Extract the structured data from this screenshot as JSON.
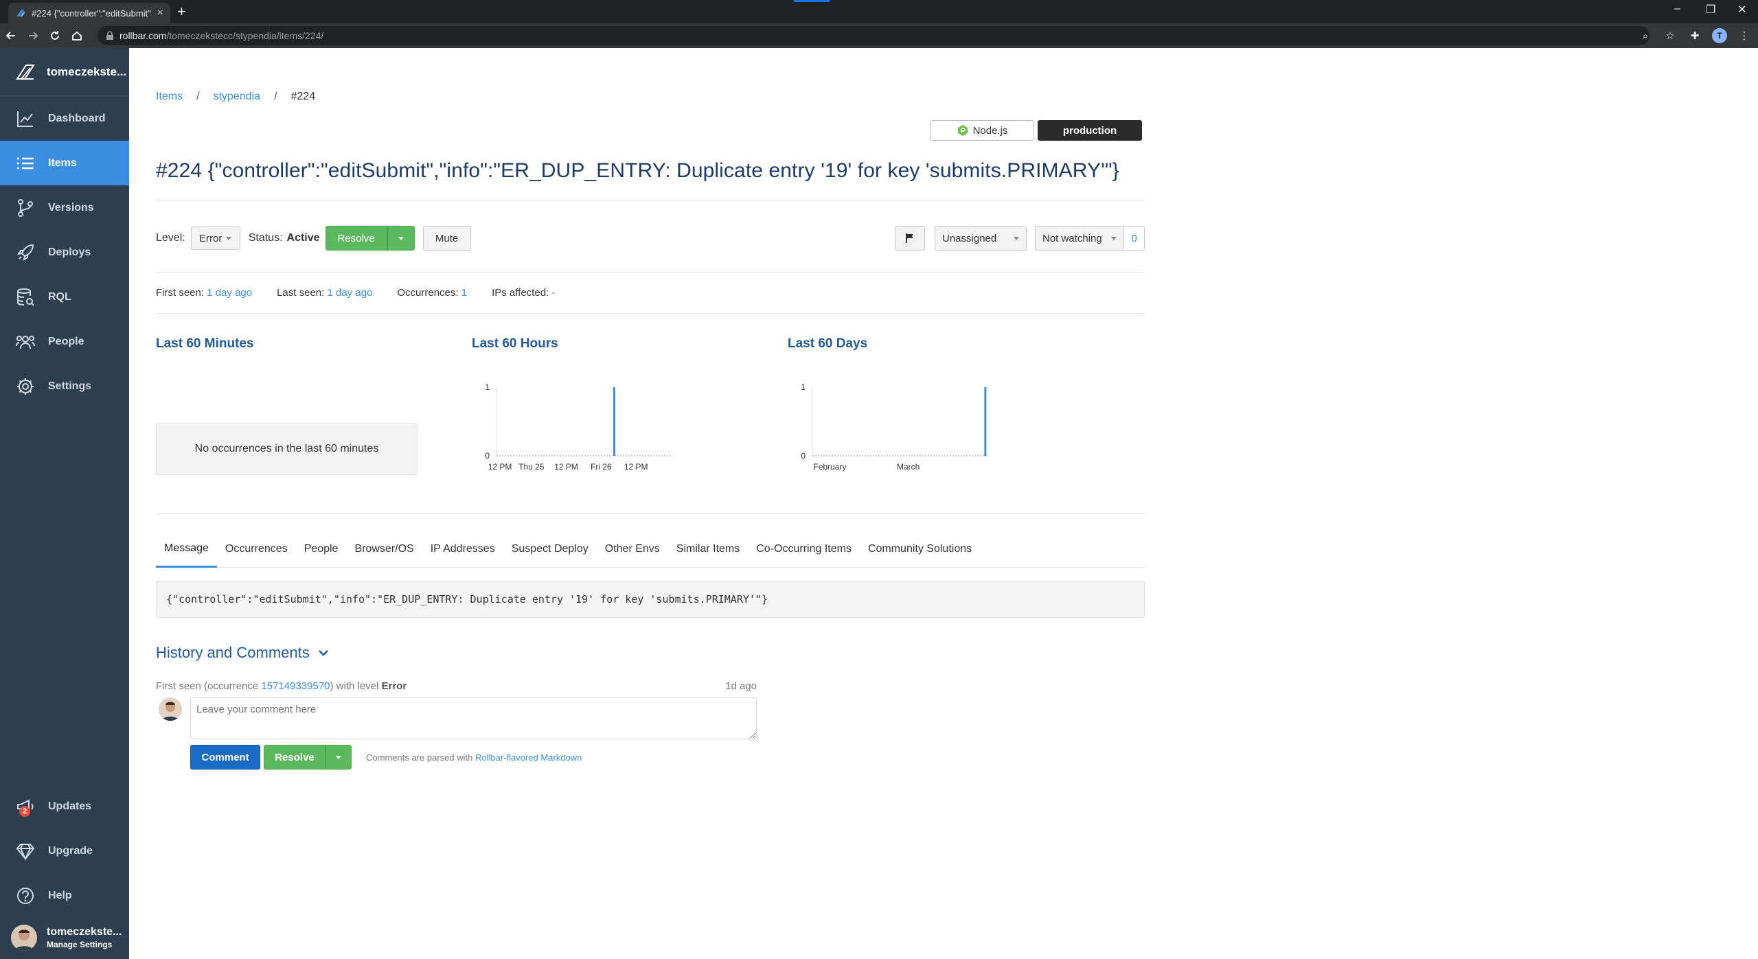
{
  "browser": {
    "tab_title": "#224 {\"controller\":\"editSubmit\",\"i",
    "url_host": "rollbar.com",
    "url_path": "/tomeczekstecc/stypendia/items/224/",
    "profile_initial": "T"
  },
  "sidebar": {
    "brand": "tomeczekste...",
    "items": [
      {
        "label": "Dashboard",
        "icon": "chart-line-icon"
      },
      {
        "label": "Items",
        "icon": "list-icon"
      },
      {
        "label": "Versions",
        "icon": "branch-icon"
      },
      {
        "label": "Deploys",
        "icon": "rocket-icon"
      },
      {
        "label": "RQL",
        "icon": "database-search-icon"
      },
      {
        "label": "People",
        "icon": "people-icon"
      },
      {
        "label": "Settings",
        "icon": "gear-icon"
      }
    ],
    "bottom_items": [
      {
        "label": "Updates",
        "icon": "megaphone-icon",
        "badge": "2"
      },
      {
        "label": "Upgrade",
        "icon": "diamond-icon"
      },
      {
        "label": "Help",
        "icon": "help-icon"
      }
    ],
    "user": {
      "name": "tomeczekste...",
      "sub": "Manage Settings"
    }
  },
  "breadcrumb": {
    "items": "Items",
    "project": "stypendia",
    "current": "#224",
    "sep": "/"
  },
  "env": {
    "platform": "Node.js",
    "environment": "production"
  },
  "title": "#224 {\"controller\":\"editSubmit\",\"info\":\"ER_DUP_ENTRY: Duplicate entry '19' for key 'submits.PRIMARY'\"}",
  "status": {
    "level_label": "Level:",
    "level_value": "Error",
    "status_label": "Status:",
    "status_value": "Active",
    "resolve": "Resolve",
    "mute": "Mute",
    "assignee": "Unassigned",
    "watching": "Not watching",
    "watch_count": "0"
  },
  "seen": {
    "first_label": "First seen:",
    "first_value": "1 day ago",
    "last_label": "Last seen:",
    "last_value": "1 day ago",
    "occ_label": "Occurrences:",
    "occ_value": "1",
    "ips_label": "IPs affected:",
    "ips_value": "-"
  },
  "charts_section": {
    "minutes_title": "Last 60 Minutes",
    "minutes_empty": "No occurrences in the last 60 minutes",
    "hours_title": "Last 60 Hours",
    "days_title": "Last 60 Days"
  },
  "chart_data": [
    {
      "type": "bar",
      "title": "Last 60 Hours",
      "x_tick_labels": [
        "12 PM",
        "Thu 25",
        "12 PM",
        "Fri 26",
        "12 PM"
      ],
      "y_tick_labels": [
        "0",
        "1"
      ],
      "ylim": [
        0,
        1
      ],
      "bins": 60,
      "values_index_of_spike": 40,
      "values": [
        0,
        0,
        0,
        0,
        0,
        0,
        0,
        0,
        0,
        0,
        0,
        0,
        0,
        0,
        0,
        0,
        0,
        0,
        0,
        0,
        0,
        0,
        0,
        0,
        0,
        0,
        0,
        0,
        0,
        0,
        0,
        0,
        0,
        0,
        0,
        0,
        0,
        0,
        0,
        0,
        1,
        0,
        0,
        0,
        0,
        0,
        0,
        0,
        0,
        0,
        0,
        0,
        0,
        0,
        0,
        0,
        0,
        0,
        0,
        0
      ],
      "color": "#3b8fe2"
    },
    {
      "type": "bar",
      "title": "Last 60 Days",
      "x_tick_labels": [
        "February",
        "March"
      ],
      "y_tick_labels": [
        "0",
        "1"
      ],
      "ylim": [
        0,
        1
      ],
      "bins": 60,
      "values": [
        0,
        0,
        0,
        0,
        0,
        0,
        0,
        0,
        0,
        0,
        0,
        0,
        0,
        0,
        0,
        0,
        0,
        0,
        0,
        0,
        0,
        0,
        0,
        0,
        0,
        0,
        0,
        0,
        0,
        0,
        0,
        0,
        0,
        0,
        0,
        0,
        0,
        0,
        0,
        0,
        0,
        0,
        0,
        0,
        0,
        0,
        0,
        0,
        0,
        0,
        0,
        0,
        0,
        0,
        0,
        0,
        0,
        0,
        0,
        1
      ],
      "color": "#3b8fe2"
    }
  ],
  "tabs": [
    "Message",
    "Occurrences",
    "People",
    "Browser/OS",
    "IP Addresses",
    "Suspect Deploy",
    "Other Envs",
    "Similar Items",
    "Co-Occurring Items",
    "Community Solutions"
  ],
  "message": "{\"controller\":\"editSubmit\",\"info\":\"ER_DUP_ENTRY: Duplicate entry '19' for key 'submits.PRIMARY'\"}",
  "history": {
    "title": "History and Comments",
    "first_seen_prefix": "First seen (occurrence ",
    "occurrence_id": "157149339570",
    "first_seen_mid": ") with level ",
    "level": "Error",
    "ago": "1d ago",
    "comment_placeholder": "Leave your comment here",
    "comment_btn": "Comment",
    "resolve_btn": "Resolve",
    "md_prefix": "Comments are parsed with ",
    "md_link": "Rollbar-flavored Markdown"
  }
}
